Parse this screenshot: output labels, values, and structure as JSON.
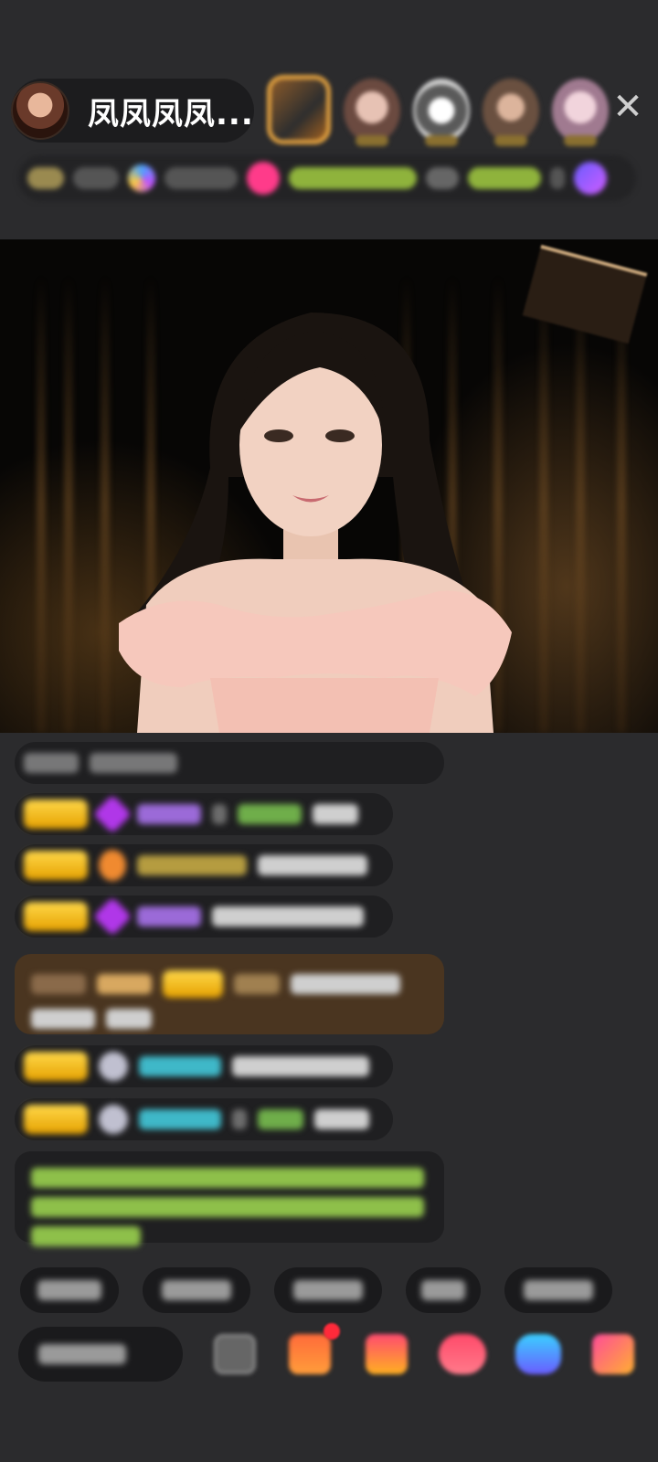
{
  "header": {
    "host_name": "凤凤凤凤...",
    "close_symbol": "✕",
    "viewer_avatars": [
      "avatar",
      "avatar",
      "avatar",
      "avatar",
      "avatar"
    ]
  },
  "colors": {
    "background": "#2b2b2d",
    "badge_gold": "#ffd84a",
    "comment_brown": "#4a3520",
    "name_purple": "#9b6ad8",
    "name_green": "#6fae4a",
    "name_cyan": "#3fb8c8"
  },
  "icons": {
    "close": "close-icon",
    "emoji": "emoji-icon",
    "red_packet": "red-packet-icon",
    "gift": "gift-icon",
    "heart": "heart-icon",
    "game": "game-icon",
    "shop": "shop-icon"
  }
}
